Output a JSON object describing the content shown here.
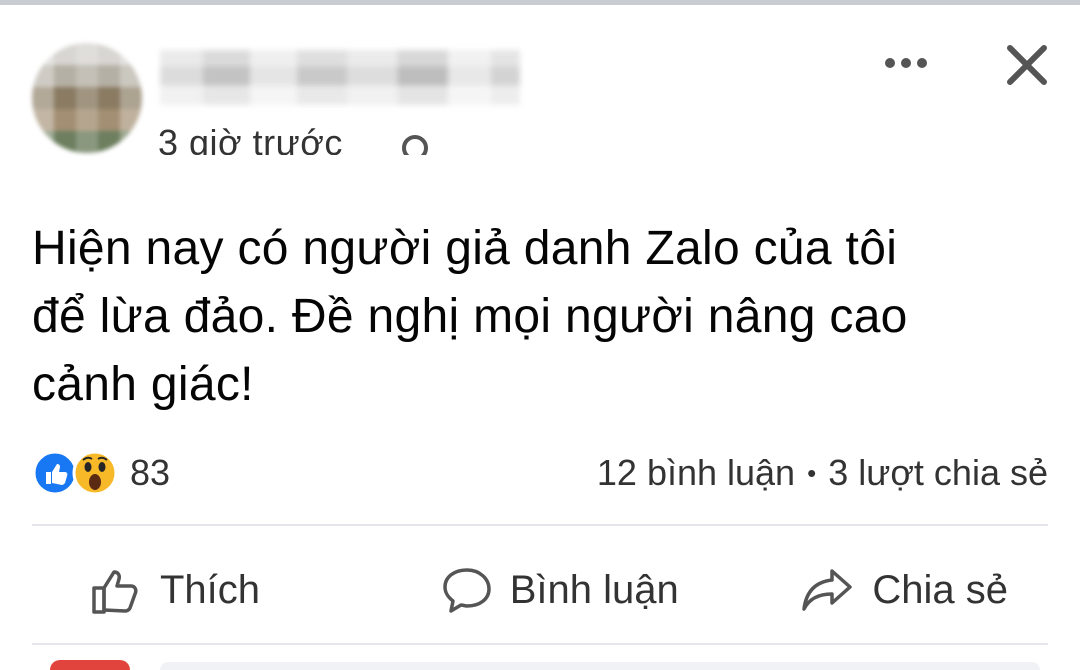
{
  "post": {
    "timestamp": "3 giờ trước",
    "text_lines": [
      "Hiện nay có người giả danh Zalo của tôi",
      "để lừa đảo. Đề nghị mọi người nâng cao",
      "cảnh giác!"
    ],
    "reactions": {
      "icons": [
        "like-icon",
        "wow-icon"
      ],
      "count": "83"
    },
    "stats": {
      "comments": "12 bình luận",
      "separator": "•",
      "shares": "3 lượt chia sẻ"
    },
    "actions": {
      "like_label": "Thích",
      "comment_label": "Bình luận",
      "share_label": "Chia sẻ"
    }
  },
  "colors": {
    "like_blue": "#1877f2",
    "wow_yellow": "#f7b928",
    "divider": "#e4e6eb",
    "text": "#050505"
  }
}
